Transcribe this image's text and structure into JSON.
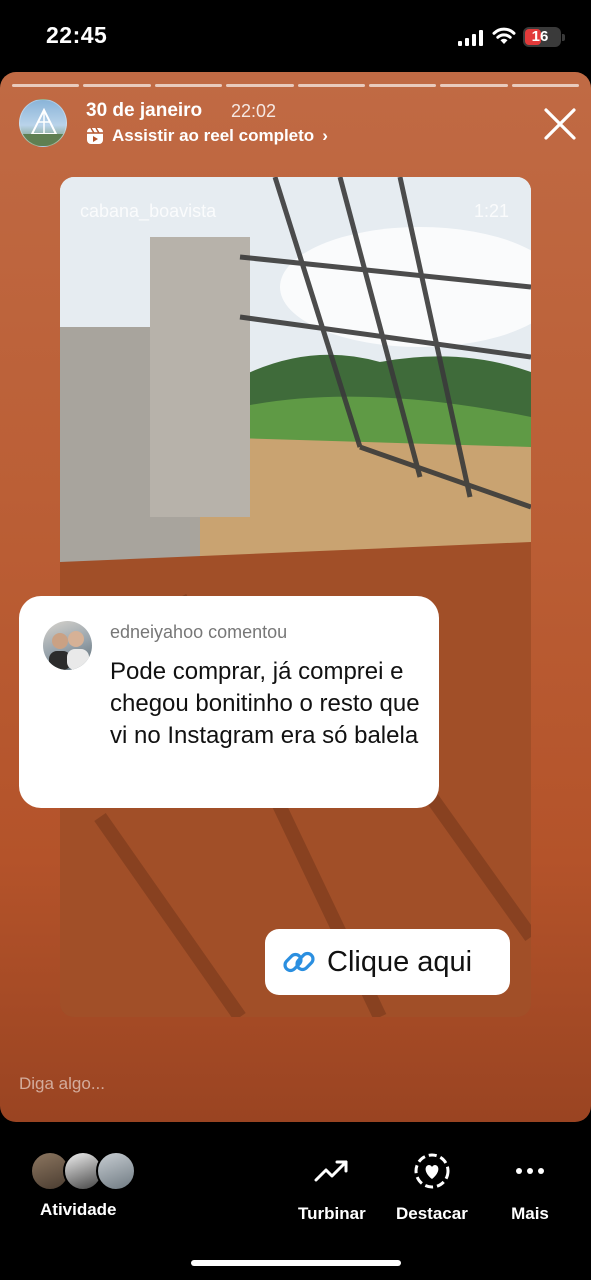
{
  "status_bar": {
    "time": "22:45",
    "battery": "16",
    "battery_color": "#e23a3a"
  },
  "story": {
    "segments": 8,
    "header": {
      "date": "30 de janeiro",
      "time": "22:02",
      "reel_link": "Assistir ao reel completo",
      "reel_link_chevron": "›"
    },
    "reel": {
      "username": "cabana_boavista",
      "duration": "1:21"
    },
    "comment": {
      "meta": "edneiyahoo comentou",
      "text": "Pode comprar, já comprei e chegou bonitinho o resto que vi no Instagram era só balela"
    },
    "link_sticker": {
      "label": "Clique aqui",
      "icon": "link-icon"
    },
    "reply_placeholder": "Diga algo..."
  },
  "bottom_bar": {
    "activity_label": "Atividade",
    "actions": [
      {
        "label": "Turbinar",
        "icon": "trending-up-icon"
      },
      {
        "label": "Destacar",
        "icon": "heart-circle-icon"
      },
      {
        "label": "Mais",
        "icon": "more-icon"
      }
    ]
  }
}
